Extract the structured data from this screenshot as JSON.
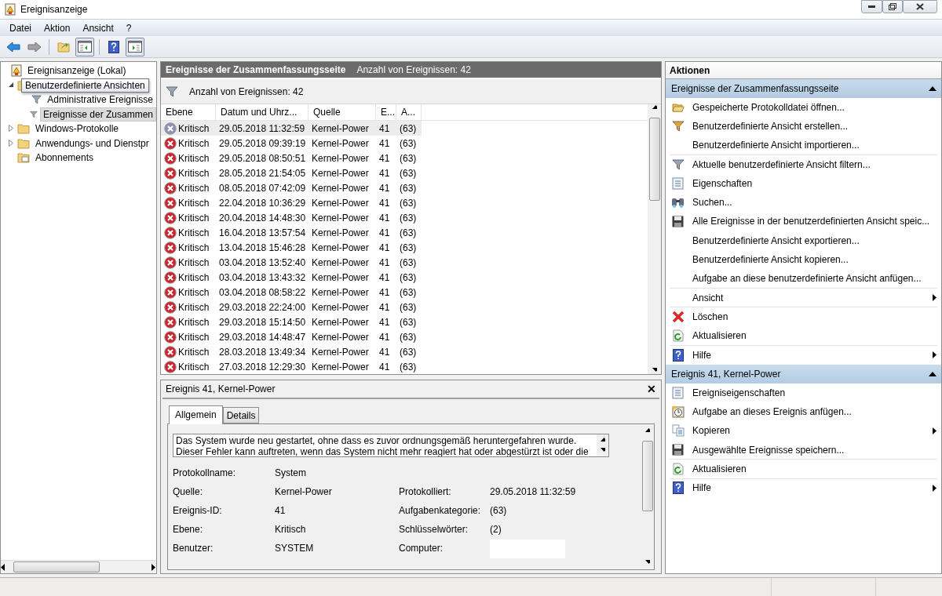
{
  "window": {
    "title": "Ereignisanzeige"
  },
  "menu": [
    "Datei",
    "Aktion",
    "Ansicht",
    "?"
  ],
  "toolbar": [
    {
      "kind": "back"
    },
    {
      "kind": "forward"
    },
    {
      "kind": "sep"
    },
    {
      "kind": "up"
    },
    {
      "kind": "tree-toggle",
      "selected": true
    },
    {
      "kind": "sep"
    },
    {
      "kind": "help"
    },
    {
      "kind": "actions-toggle",
      "selected": true
    }
  ],
  "tree": [
    {
      "label": "Ereignisanzeige (Lokal)",
      "kind": "root",
      "selected": false,
      "children": [
        {
          "label": "Benutzerdefinierte Ansichten",
          "kind": "folder",
          "expanded": true,
          "tooltip": true,
          "children": [
            {
              "label": "Administrative Ereignisse",
              "kind": "filter",
              "selected": false
            },
            {
              "label": "Ereignisse der Zusammen",
              "kind": "filter",
              "selected": true
            }
          ]
        },
        {
          "label": "Windows-Protokolle",
          "kind": "folder",
          "expanded": false,
          "selected": false,
          "tooltip": false
        },
        {
          "label": "Anwendungs- und Dienstpr",
          "kind": "folder",
          "expanded": false,
          "selected": false,
          "tooltip": false
        },
        {
          "label": "Abonnements",
          "kind": "subscriptions",
          "selected": false,
          "tooltip": false
        }
      ]
    }
  ],
  "list_header": {
    "title": "Ereignisse der Zusammenfassungsseite",
    "count": "Anzahl von Ereignissen: 42"
  },
  "filter_bar": {
    "text": "Anzahl von Ereignissen: 42"
  },
  "table": {
    "columns": [
      "Ebene",
      "Datum und Uhrz...",
      "Quelle",
      "E...",
      "A..."
    ],
    "rows": [
      {
        "level": "Kritisch",
        "date": "29.05.2018 11:32:59",
        "source": "Kernel-Power",
        "id": "41",
        "category": "(63)",
        "selected": true
      },
      {
        "level": "Kritisch",
        "date": "29.05.2018 09:39:19",
        "source": "Kernel-Power",
        "id": "41",
        "category": "(63)",
        "selected": false
      },
      {
        "level": "Kritisch",
        "date": "29.05.2018 08:50:51",
        "source": "Kernel-Power",
        "id": "41",
        "category": "(63)",
        "selected": false
      },
      {
        "level": "Kritisch",
        "date": "28.05.2018 21:54:05",
        "source": "Kernel-Power",
        "id": "41",
        "category": "(63)",
        "selected": false
      },
      {
        "level": "Kritisch",
        "date": "08.05.2018 07:42:09",
        "source": "Kernel-Power",
        "id": "41",
        "category": "(63)",
        "selected": false
      },
      {
        "level": "Kritisch",
        "date": "22.04.2018 10:36:29",
        "source": "Kernel-Power",
        "id": "41",
        "category": "(63)",
        "selected": false
      },
      {
        "level": "Kritisch",
        "date": "20.04.2018 14:48:30",
        "source": "Kernel-Power",
        "id": "41",
        "category": "(63)",
        "selected": false
      },
      {
        "level": "Kritisch",
        "date": "16.04.2018 13:57:54",
        "source": "Kernel-Power",
        "id": "41",
        "category": "(63)",
        "selected": false
      },
      {
        "level": "Kritisch",
        "date": "13.04.2018 15:46:28",
        "source": "Kernel-Power",
        "id": "41",
        "category": "(63)",
        "selected": false
      },
      {
        "level": "Kritisch",
        "date": "03.04.2018 13:52:40",
        "source": "Kernel-Power",
        "id": "41",
        "category": "(63)",
        "selected": false
      },
      {
        "level": "Kritisch",
        "date": "03.04.2018 13:43:32",
        "source": "Kernel-Power",
        "id": "41",
        "category": "(63)",
        "selected": false
      },
      {
        "level": "Kritisch",
        "date": "03.04.2018 08:58:22",
        "source": "Kernel-Power",
        "id": "41",
        "category": "(63)",
        "selected": false
      },
      {
        "level": "Kritisch",
        "date": "29.03.2018 22:24:00",
        "source": "Kernel-Power",
        "id": "41",
        "category": "(63)",
        "selected": false
      },
      {
        "level": "Kritisch",
        "date": "29.03.2018 15:14:50",
        "source": "Kernel-Power",
        "id": "41",
        "category": "(63)",
        "selected": false
      },
      {
        "level": "Kritisch",
        "date": "29.03.2018 14:48:47",
        "source": "Kernel-Power",
        "id": "41",
        "category": "(63)",
        "selected": false
      },
      {
        "level": "Kritisch",
        "date": "28.03.2018 13:49:34",
        "source": "Kernel-Power",
        "id": "41",
        "category": "(63)",
        "selected": false
      },
      {
        "level": "Kritisch",
        "date": "27.03.2018 12:29:30",
        "source": "Kernel-Power",
        "id": "41",
        "category": "(63)",
        "selected": false
      }
    ]
  },
  "detail": {
    "title": "Ereignis 41, Kernel-Power",
    "close": "✕",
    "tabs": [
      {
        "label": "Allgemein",
        "selected": true
      },
      {
        "label": "Details",
        "selected": false
      }
    ],
    "description": [
      "Das System wurde neu gestartet, ohne dass es zuvor ordnungsgemäß heruntergefahren wurde.",
      "Dieser Fehler kann auftreten, wenn das System nicht mehr reagiert hat oder abgestürzt ist oder die"
    ],
    "properties": [
      [
        {
          "label": "Protokollname:",
          "value": "System"
        }
      ],
      [
        {
          "label": "Quelle:",
          "value": "Kernel-Power"
        },
        {
          "label": "Protokolliert:",
          "value": "29.05.2018 11:32:59"
        }
      ],
      [
        {
          "label": "Ereignis-ID:",
          "value": "41"
        },
        {
          "label": "Aufgabenkategorie:",
          "value": "(63)"
        }
      ],
      [
        {
          "label": "Ebene:",
          "value": "Kritisch"
        },
        {
          "label": "Schlüsselwörter:",
          "value": "(2)"
        }
      ],
      [
        {
          "label": "Benutzer:",
          "value": "SYSTEM"
        },
        {
          "label": "Computer:",
          "redacted": true
        }
      ]
    ]
  },
  "actions": {
    "title": "Aktionen",
    "sections": [
      {
        "title": "Ereignisse der Zusammenfassungsseite",
        "expanded": true,
        "items": [
          {
            "label": "Gespeicherte Protokolldatei öffnen...",
            "kind": "open"
          },
          {
            "label": "Benutzerdefinierte Ansicht erstellen...",
            "kind": "create-filter"
          },
          {
            "label": "Benutzerdefinierte Ansicht importieren...",
            "kind": "none",
            "divider_after": true
          },
          {
            "label": "Aktuelle benutzerdefinierte Ansicht filtern...",
            "kind": "filter"
          },
          {
            "label": "Eigenschaften",
            "kind": "properties"
          },
          {
            "label": "Suchen...",
            "kind": "find"
          },
          {
            "label": "Alle Ereignisse in der benutzerdefinierten Ansicht speic...",
            "kind": "save"
          },
          {
            "label": "Benutzerdefinierte Ansicht exportieren...",
            "kind": "none"
          },
          {
            "label": "Benutzerdefinierte Ansicht kopieren...",
            "kind": "none"
          },
          {
            "label": "Aufgabe an diese benutzerdefinierte Ansicht anfügen...",
            "kind": "none",
            "divider_after": true
          },
          {
            "label": "Ansicht",
            "kind": "none",
            "submenu": true,
            "divider_after": true
          },
          {
            "label": "Löschen",
            "kind": "delete"
          },
          {
            "label": "Aktualisieren",
            "kind": "refresh",
            "divider_after": true
          },
          {
            "label": "Hilfe",
            "kind": "help",
            "submenu": true
          }
        ]
      },
      {
        "title": "Ereignis 41, Kernel-Power",
        "expanded": true,
        "items": [
          {
            "label": "Ereigniseigenschaften",
            "kind": "properties"
          },
          {
            "label": "Aufgabe an dieses Ereignis anfügen...",
            "kind": "task"
          },
          {
            "label": "Kopieren",
            "kind": "copy",
            "submenu": true
          },
          {
            "label": "Ausgewählte Ereignisse speichern...",
            "kind": "save",
            "divider_after": true
          },
          {
            "label": "Aktualisieren",
            "kind": "refresh",
            "divider_after": true
          },
          {
            "label": "Hilfe",
            "kind": "help",
            "submenu": true
          }
        ]
      }
    ]
  }
}
